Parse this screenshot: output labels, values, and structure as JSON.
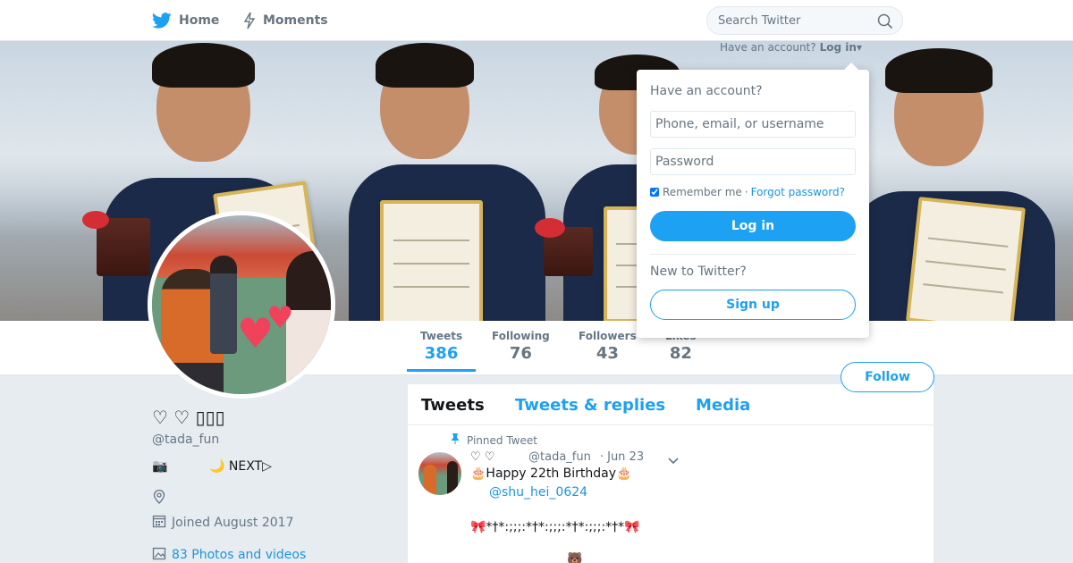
{
  "nav": {
    "home_label": "Home",
    "moments_label": "Moments",
    "search_placeholder": "Search Twitter",
    "home_icon": "twitter-bird-icon",
    "moments_icon": "lightning-icon",
    "search_icon": "magnifier-icon"
  },
  "banner": {
    "prompt": "Have an account?",
    "login_link": "Log in"
  },
  "login_dropdown": {
    "title": "Have an account?",
    "username_placeholder": "Phone, email, or username",
    "password_placeholder": "Password",
    "remember_me": "Remember me",
    "separator": "·",
    "forgot_password": "Forgot password?",
    "login_button": "Log in",
    "new_prompt": "New to Twitter?",
    "signup_button": "Sign up",
    "remember_checked": true
  },
  "stats": {
    "tweets": {
      "label": "Tweets",
      "value": "386"
    },
    "following": {
      "label": "Following",
      "value": "76"
    },
    "followers": {
      "label": "Followers",
      "value": "43"
    },
    "likes": {
      "label": "Likes",
      "value": "82"
    }
  },
  "follow_button": "Follow",
  "profile": {
    "name": "♡ ♡ ▯▯▯",
    "handle": "@tada_fun",
    "bio_camera": "📷",
    "bio_next": "🌙 NEXT▷",
    "joined": "Joined August 2017",
    "photos": "83 Photos and videos"
  },
  "timeline": {
    "tabs": [
      "Tweets",
      "Tweets & replies",
      "Media"
    ],
    "pinned_label": "Pinned Tweet",
    "tweet": {
      "name": "♡ ♡",
      "handle": "@tada_fun",
      "date": "· Jun 23",
      "line1": "🎂Happy 22th Birthday🎂",
      "mention": "@shu_hei_0624",
      "line3": "🎀*†*:;;;:*†*:;;;:*†*:;;;:*†*🎀",
      "line4": "🐻"
    }
  },
  "colors": {
    "accent": "#1da1f2",
    "link": "#1b95e0",
    "text_secondary": "#657786",
    "background": "#e6ecf0"
  }
}
